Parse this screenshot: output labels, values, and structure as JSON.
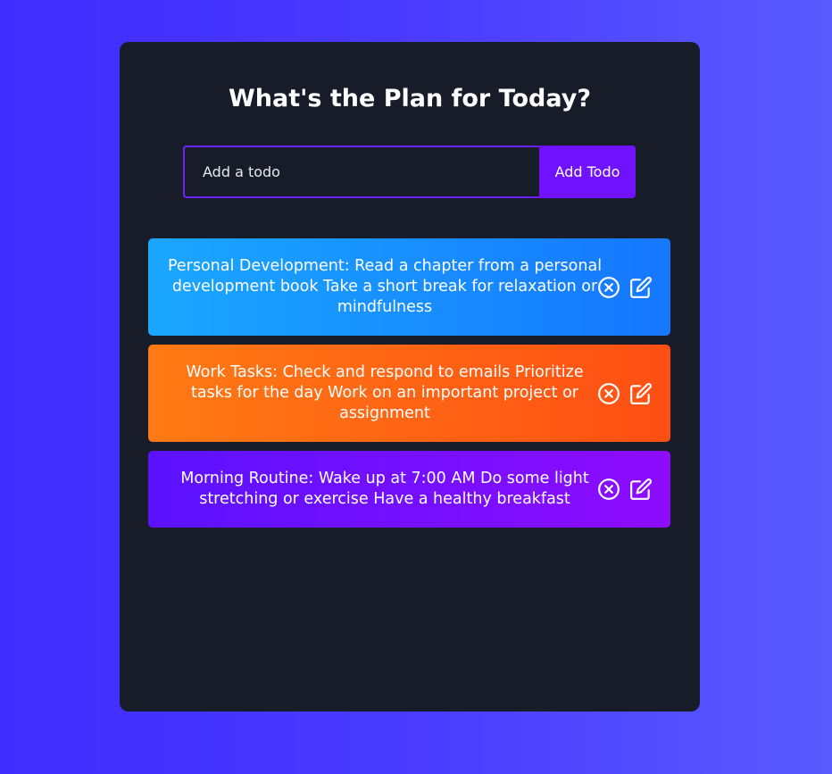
{
  "header": {
    "title": "What's the Plan for Today?"
  },
  "form": {
    "input_placeholder": "Add a todo",
    "input_value": "",
    "add_button_label": "Add Todo"
  },
  "todos": [
    {
      "text": "Personal Development: Read a chapter from a personal development book Take a short break for relaxation or mindfulness",
      "delete_icon": "close-circle-icon",
      "edit_icon": "edit-icon"
    },
    {
      "text": "Work Tasks: Check and respond to emails Prioritize tasks for the day Work on an important project or assignment",
      "delete_icon": "close-circle-icon",
      "edit_icon": "edit-icon"
    },
    {
      "text": "Morning Routine: Wake up at 7:00 AM Do some light stretching or exercise Have a healthy breakfast",
      "delete_icon": "close-circle-icon",
      "edit_icon": "edit-icon"
    }
  ],
  "colors": {
    "background_start": "#3f2cff",
    "background_end": "#5a5aff",
    "panel": "#171c28",
    "accent": "#7012ff",
    "todo_blue": "#1677ff",
    "todo_orange": "#ff5a14",
    "todo_purple": "#7a0fff"
  }
}
